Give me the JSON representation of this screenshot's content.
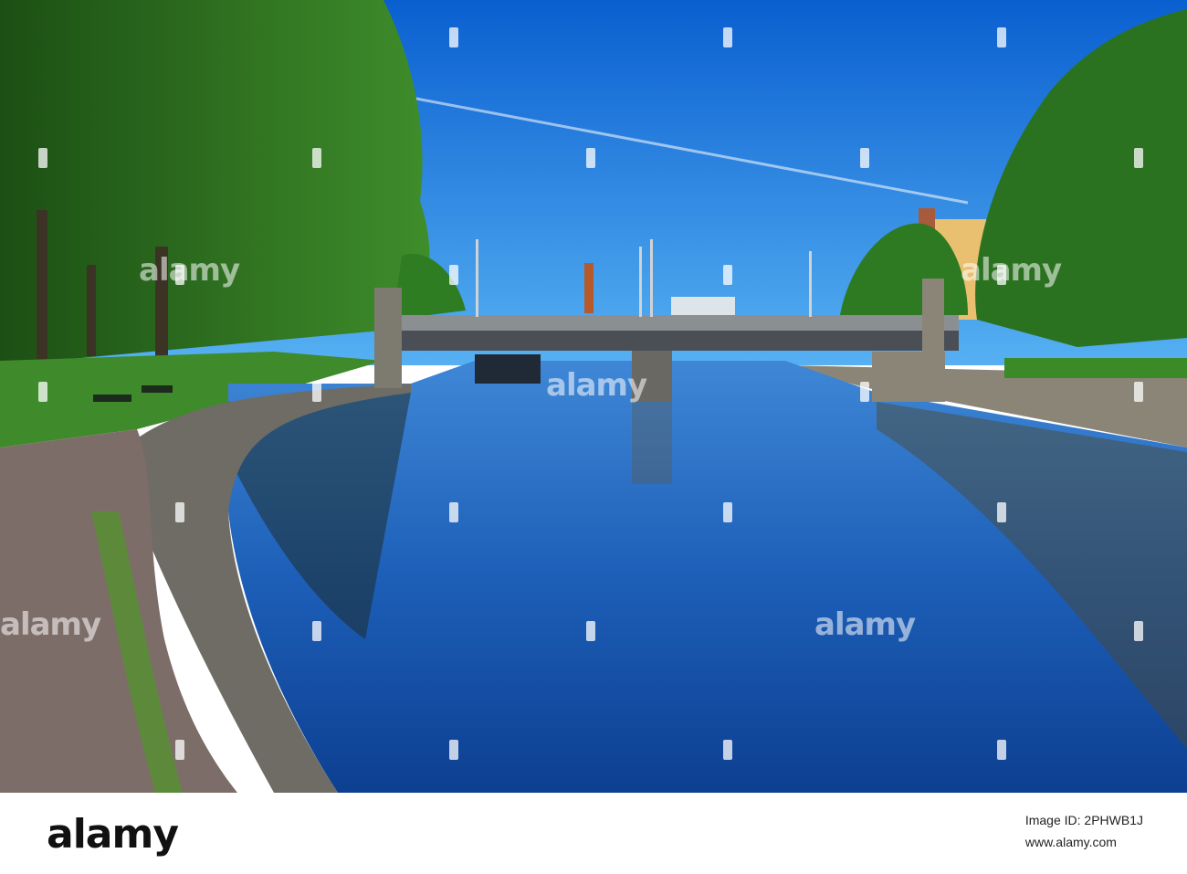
{
  "watermark": {
    "brand": "alamy"
  },
  "footer": {
    "logo": "alamy",
    "image_id_label": "Image ID: 2PHWB1J",
    "site": "www.alamy.com"
  },
  "palette": {
    "sky_top": "#0b6fd6",
    "sky_bottom": "#4aa6ef",
    "water": "#1a5fb8",
    "foliage": "#2f7d22",
    "stone": "#6b6a63"
  }
}
